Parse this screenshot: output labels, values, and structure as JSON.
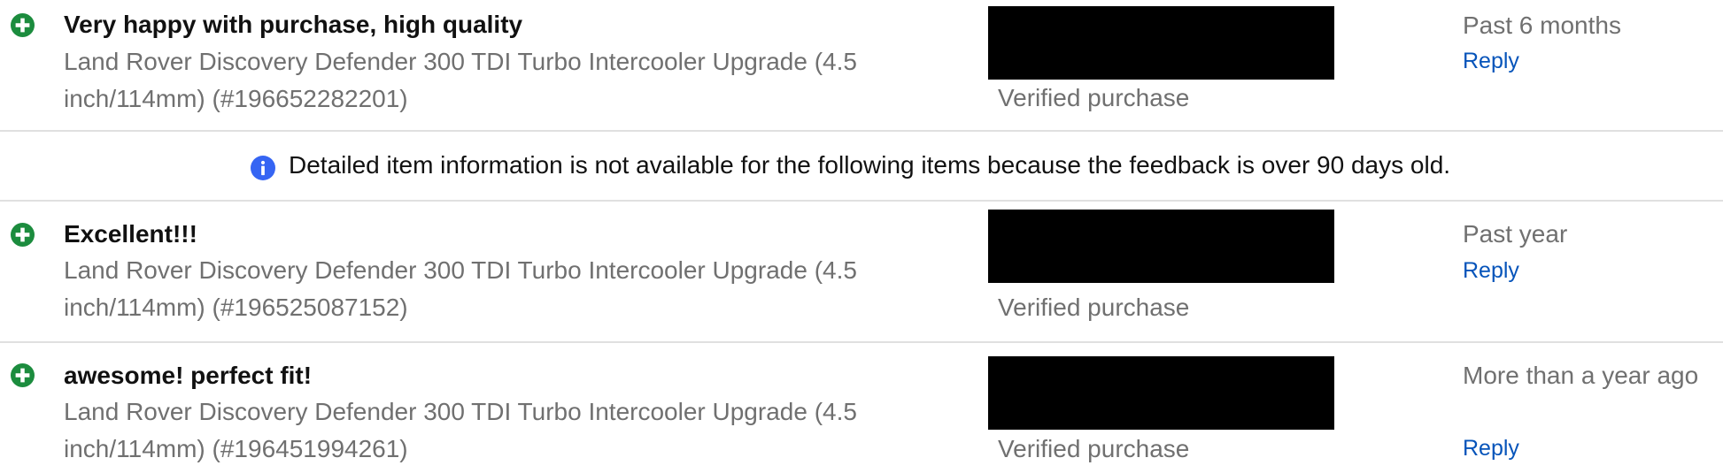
{
  "notice": {
    "text": "Detailed item information is not available for the following items because the feedback is over 90 days old.",
    "icon": "info-icon"
  },
  "colors": {
    "positive": "#1c8c3e",
    "info": "#3665f3",
    "link": "#0654ba",
    "muted": "#707070",
    "text": "#111111"
  },
  "feedback": [
    {
      "rating_icon": "plus-circle-icon",
      "comment": "Very happy with purchase, high quality",
      "item_line1": "Land Rover Discovery Defender 300 TDI Turbo Intercooler Upgrade (4.5",
      "item_line2": "inch/114mm) (#196652282201)",
      "verified": "Verified purchase",
      "when": "Past 6 months",
      "reply": "Reply"
    },
    {
      "rating_icon": "plus-circle-icon",
      "comment": "Excellent!!!",
      "item_line1": "Land Rover Discovery Defender 300 TDI Turbo Intercooler Upgrade (4.5",
      "item_line2": "inch/114mm) (#196525087152)",
      "verified": "Verified purchase",
      "when": "Past year",
      "reply": "Reply"
    },
    {
      "rating_icon": "plus-circle-icon",
      "comment": "awesome! perfect fit!",
      "item_line1": "Land Rover Discovery Defender 300 TDI Turbo Intercooler Upgrade (4.5",
      "item_line2": "inch/114mm) (#196451994261)",
      "verified": "Verified purchase",
      "when": "More than a year ago",
      "reply": "Reply"
    }
  ]
}
